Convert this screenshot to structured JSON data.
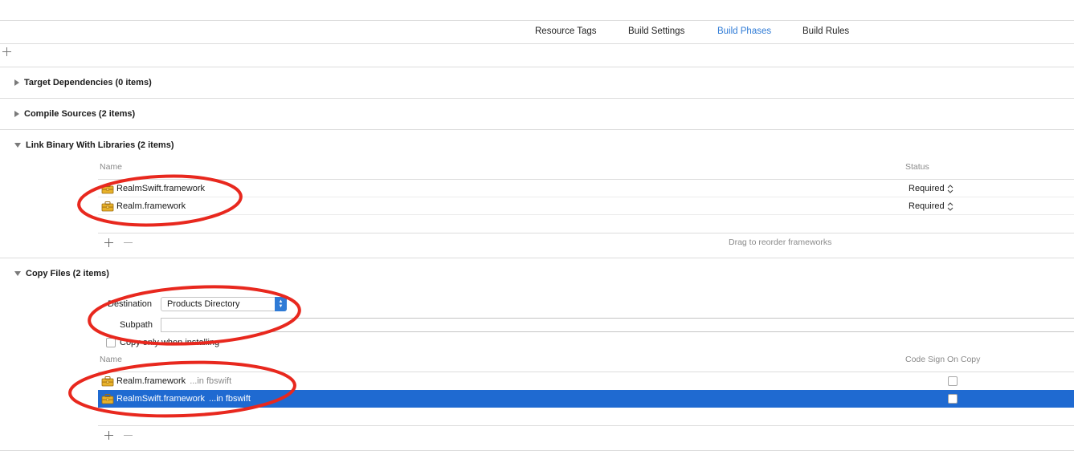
{
  "tabs": [
    {
      "label": "Resource Tags",
      "active": false
    },
    {
      "label": "Build Settings",
      "active": false
    },
    {
      "label": "Build Phases",
      "active": true
    },
    {
      "label": "Build Rules",
      "active": false
    }
  ],
  "sections": {
    "target_dependencies": {
      "title": "Target Dependencies (0 items)",
      "expanded": false
    },
    "compile_sources": {
      "title": "Compile Sources (2 items)",
      "expanded": false
    },
    "link_binary": {
      "title": "Link Binary With Libraries (2 items)",
      "expanded": true,
      "col_name": "Name",
      "col_status": "Status",
      "rows": [
        {
          "name": "RealmSwift.framework",
          "status": "Required"
        },
        {
          "name": "Realm.framework",
          "status": "Required"
        }
      ],
      "hint": "Drag to reorder frameworks"
    },
    "copy_files": {
      "title": "Copy Files (2 items)",
      "expanded": true,
      "destination_label": "Destination",
      "destination_value": "Products Directory",
      "subpath_label": "Subpath",
      "subpath_value": "",
      "copy_only_label": "Copy only when installing",
      "copy_only_checked": false,
      "col_name": "Name",
      "col_code_sign": "Code Sign On Copy",
      "rows": [
        {
          "name": "Realm.framework",
          "path": "...in fbswift",
          "code_sign": false,
          "selected": false
        },
        {
          "name": "RealmSwift.framework",
          "path": "...in fbswift",
          "code_sign": false,
          "selected": true
        }
      ]
    }
  },
  "colors": {
    "accent": "#2f7bd6",
    "selection": "#1f6ad1",
    "annotation": "#e8281e",
    "icon": "#e8b22a"
  },
  "icons": {
    "framework": "toolbox-icon",
    "expand": "disclosure-triangle-icon",
    "stepper": "up-down-chevron-icon"
  }
}
